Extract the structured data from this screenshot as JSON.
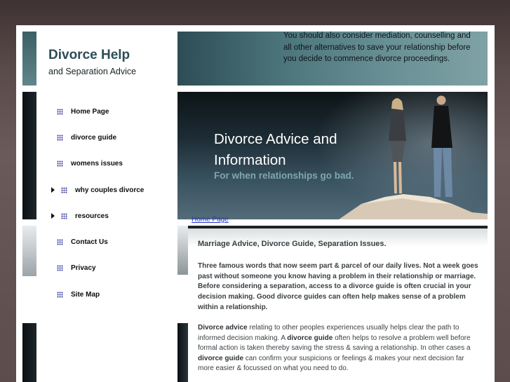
{
  "header": {
    "brand_title": "Divorce Help",
    "brand_subtitle": "and Separation Advice",
    "message": "You should also consider mediation, counselling and all other alternatives to save your relationship before you decide to commence divorce proceedings."
  },
  "nav": {
    "items": [
      {
        "label": "Home Page",
        "icon": "grid-icon",
        "has_arrow": false
      },
      {
        "label": "divorce guide",
        "icon": "grid-icon",
        "has_arrow": false
      },
      {
        "label": "womens issues",
        "icon": "grid-icon",
        "has_arrow": false
      },
      {
        "label": "why couples divorce",
        "icon": "grid-icon",
        "has_arrow": true
      },
      {
        "label": "resources",
        "icon": "grid-icon",
        "has_arrow": true
      },
      {
        "label": "Contact Us",
        "icon": "grid-icon",
        "has_arrow": false
      },
      {
        "label": "Privacy",
        "icon": "grid-icon",
        "has_arrow": false
      },
      {
        "label": "Site Map",
        "icon": "grid-icon",
        "has_arrow": false
      }
    ]
  },
  "hero": {
    "title": "Divorce Advice and Information",
    "subtitle": "For when relationships go bad."
  },
  "breadcrumb": {
    "home_link": "Home Page"
  },
  "content": {
    "heading": "Marriage Advice, Divorce Guide, Separation Issues.",
    "intro": "Three famous words that now seem part & parcel of our daily lives. Not a week goes past without someone you know having a problem in their relationship or marriage.  Before considering a separation, access to a divorce guide is often crucial in your decision making.  Good divorce guides can often help makes sense of a problem within a relationship.",
    "p2": {
      "t1": "Divorce advice",
      "t2": " relating to other peoples experiences usually helps clear the path to informed decision making. A ",
      "t3": "divorce guide",
      "t4": " often helps to resolve a problem well before formal action is taken thereby saving the stress & saving a relationship.  In other cases a ",
      "t5": "divorce guide",
      "t6": " can confirm your suspicions or feelings & makes your next decision far more easier & focussed on what you need to do."
    }
  },
  "colors": {
    "brand": "#2e4d56",
    "hero_subtitle": "#7fa6ae",
    "link": "#2233cc",
    "nav_icon": "#3a3d9e"
  }
}
